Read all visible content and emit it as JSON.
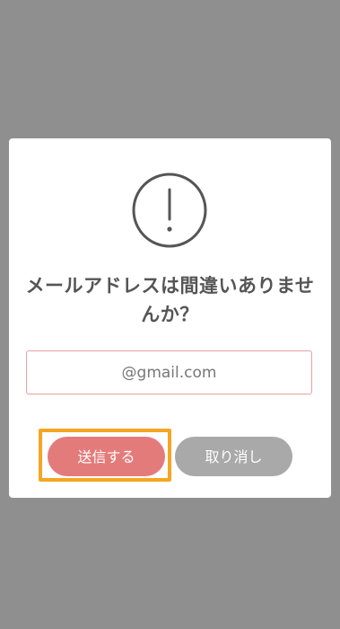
{
  "dialog": {
    "title": "メールアドレスは間違いありませんか？",
    "email_value": "@gmail.com",
    "icon": "exclamation-circle-icon",
    "send_label": "送信する",
    "cancel_label": "取り消し"
  },
  "colors": {
    "overlay": "#8f8f8f",
    "send_button": "#e47b7b",
    "cancel_button": "#a9a9a9",
    "input_border": "#e8a0a0",
    "highlight": "#f5a623"
  }
}
